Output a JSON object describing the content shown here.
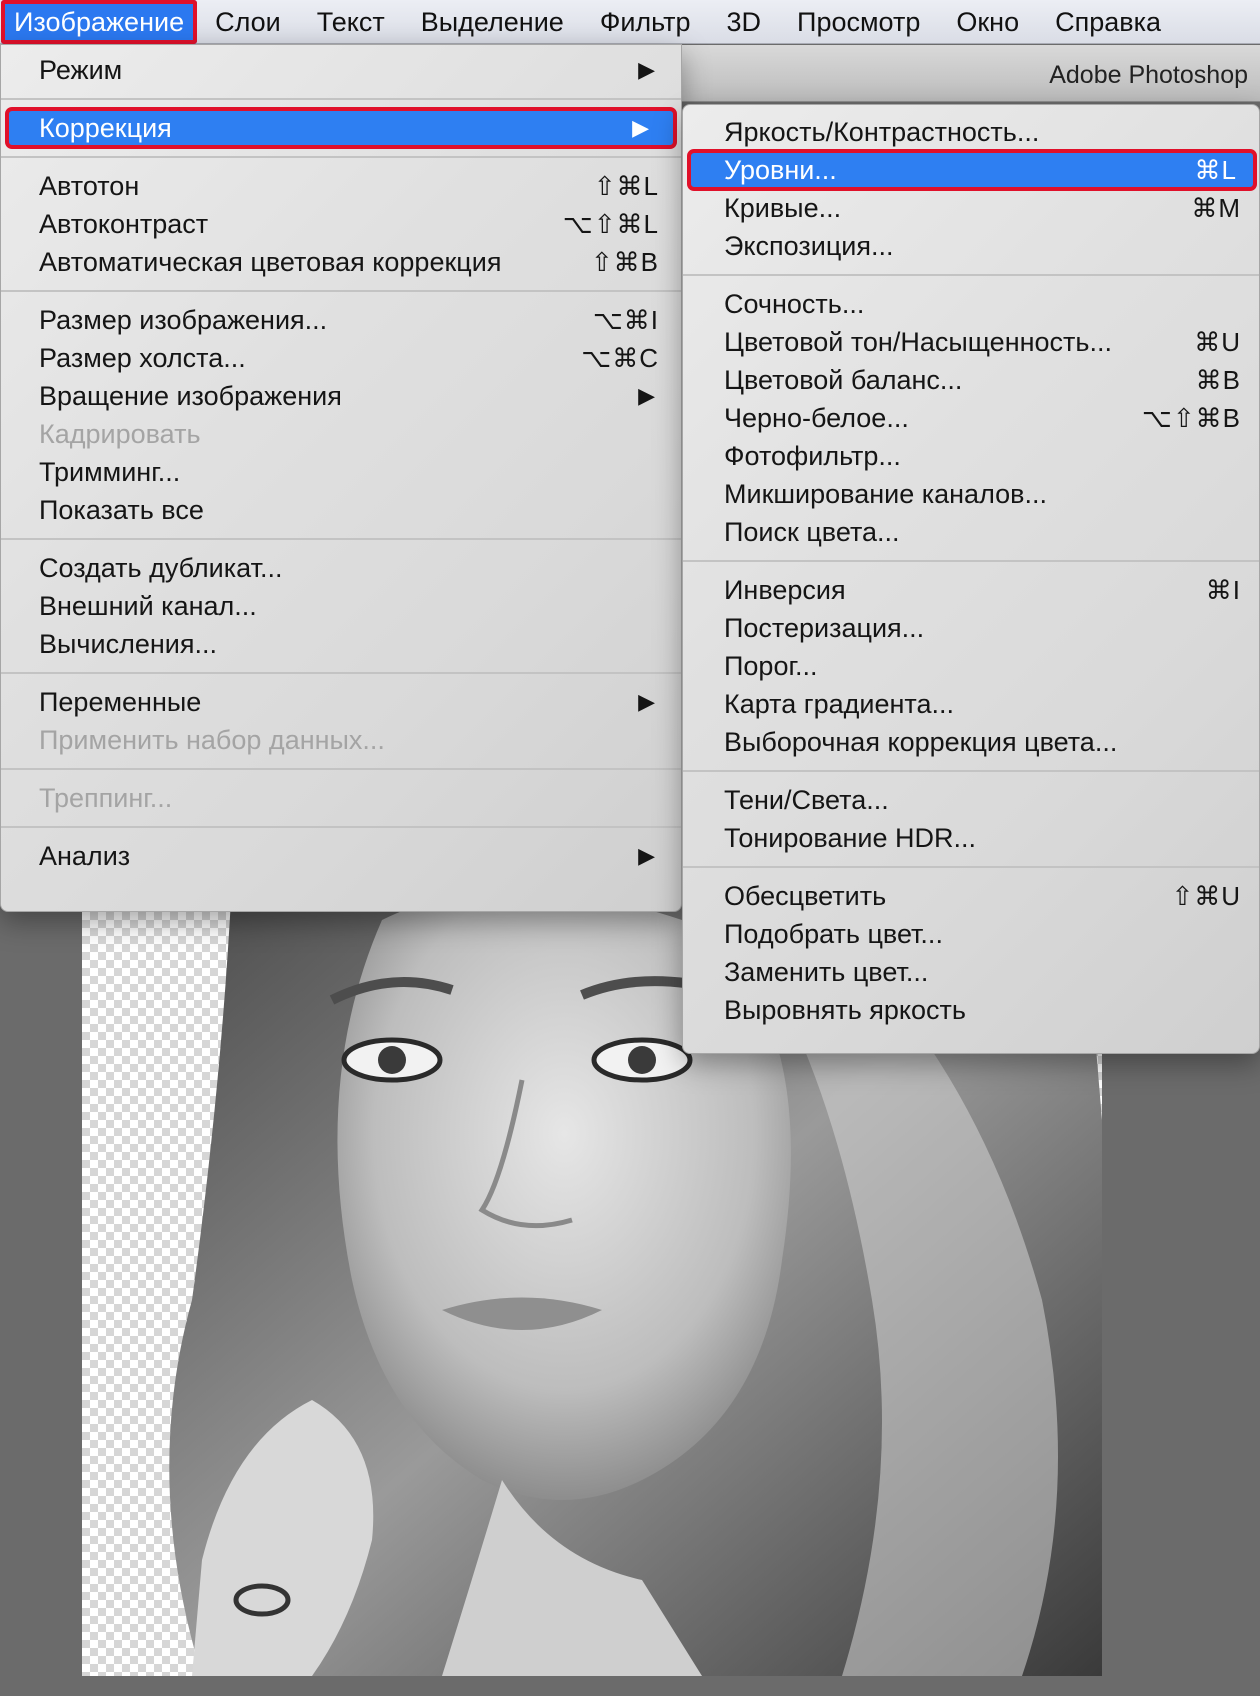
{
  "menubar": {
    "items": [
      "Изображение",
      "Слои",
      "Текст",
      "Выделение",
      "Фильтр",
      "3D",
      "Просмотр",
      "Окно",
      "Справка"
    ]
  },
  "app_title": "Adobe Photoshop",
  "image_menu": {
    "mode": {
      "label": "Режим"
    },
    "correction": {
      "label": "Коррекция"
    },
    "autotone": {
      "label": "Автотон",
      "shortcut": "⇧⌘L"
    },
    "autocontrast": {
      "label": "Автоконтраст",
      "shortcut": "⌥⇧⌘L"
    },
    "autocolor": {
      "label": "Автоматическая цветовая коррекция",
      "shortcut": "⇧⌘B"
    },
    "image_size": {
      "label": "Размер изображения...",
      "shortcut": "⌥⌘I"
    },
    "canvas_size": {
      "label": "Размер холста...",
      "shortcut": "⌥⌘C"
    },
    "rotation": {
      "label": "Вращение изображения"
    },
    "crop": {
      "label": "Кадрировать"
    },
    "trim": {
      "label": "Тримминг..."
    },
    "reveal_all": {
      "label": "Показать все"
    },
    "duplicate": {
      "label": "Создать дубликат..."
    },
    "apply_image": {
      "label": "Внешний канал..."
    },
    "calculations": {
      "label": "Вычисления..."
    },
    "variables": {
      "label": "Переменные"
    },
    "apply_dataset": {
      "label": "Применить набор данных..."
    },
    "trap": {
      "label": "Треппинг..."
    },
    "analysis": {
      "label": "Анализ"
    }
  },
  "correction_menu": {
    "brightness_contrast": {
      "label": "Яркость/Контрастность..."
    },
    "levels": {
      "label": "Уровни...",
      "shortcut": "⌘L"
    },
    "curves": {
      "label": "Кривые...",
      "shortcut": "⌘M"
    },
    "exposure": {
      "label": "Экспозиция..."
    },
    "vibrance": {
      "label": "Сочность..."
    },
    "hue_saturation": {
      "label": "Цветовой тон/Насыщенность...",
      "shortcut": "⌘U"
    },
    "color_balance": {
      "label": "Цветовой баланс...",
      "shortcut": "⌘B"
    },
    "black_white": {
      "label": "Черно-белое...",
      "shortcut": "⌥⇧⌘B"
    },
    "photo_filter": {
      "label": "Фотофильтр..."
    },
    "channel_mixer": {
      "label": "Микширование каналов..."
    },
    "color_lookup": {
      "label": "Поиск цвета..."
    },
    "invert": {
      "label": "Инверсия",
      "shortcut": "⌘I"
    },
    "posterize": {
      "label": "Постеризация..."
    },
    "threshold": {
      "label": "Порог..."
    },
    "gradient_map": {
      "label": "Карта градиента..."
    },
    "selective_color": {
      "label": "Выборочная коррекция цвета..."
    },
    "shadows_highlights": {
      "label": "Тени/Света..."
    },
    "hdr_toning": {
      "label": "Тонирование HDR..."
    },
    "desaturate": {
      "label": "Обесцветить",
      "shortcut": "⇧⌘U"
    },
    "match_color": {
      "label": "Подобрать цвет..."
    },
    "replace_color": {
      "label": "Заменить цвет..."
    },
    "equalize": {
      "label": "Выровнять яркость"
    }
  },
  "colors": {
    "accent": "#2e7ff2",
    "annotation": "#e0102a"
  }
}
